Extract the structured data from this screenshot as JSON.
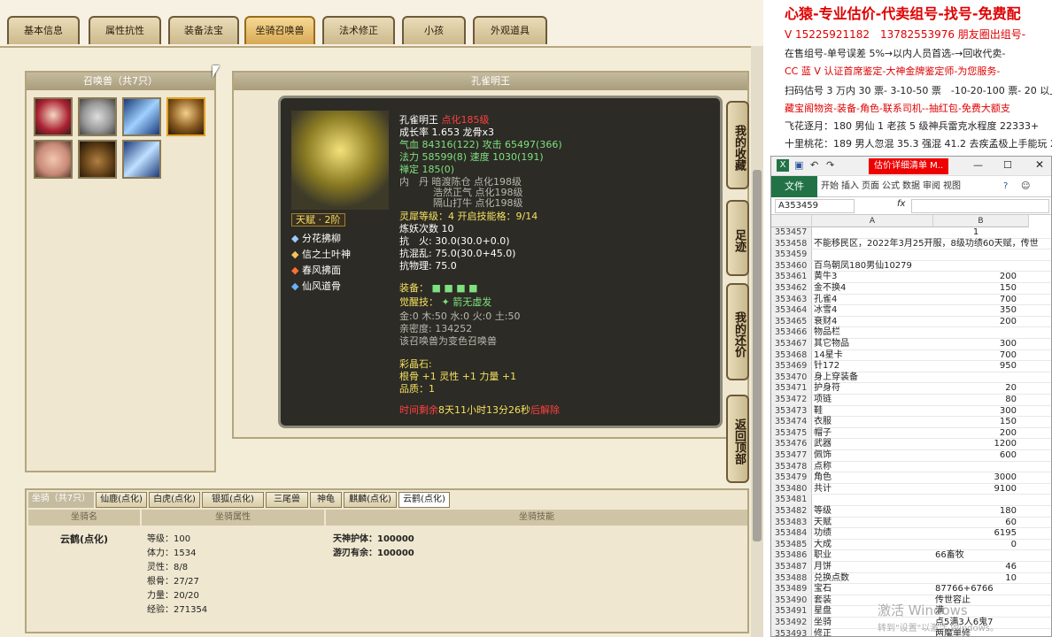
{
  "game": {
    "tabs": [
      "基本信息",
      "属性抗性",
      "装备法宝",
      "坐骑召唤兽",
      "法术修正",
      "小孩",
      "外观道具"
    ],
    "active_tab": 3,
    "pet_panel_title": "召唤兽（共7只）",
    "detail_title": "孔雀明王",
    "tooltip": {
      "name": "孔雀明王",
      "name_tag": "点化185级",
      "growth": "成长率 1.653 龙骨x3",
      "hp": "气血 84316(122) 攻击 65497(366)",
      "mp": "法力 58599(8) 速度 1030(191)",
      "zen": "禅定 185(0)",
      "inner1": "内　丹 暗渡陈仓 点化198级",
      "inner2": "浩然正气 点化198级",
      "inner3": "隔山打牛 点化198级",
      "talent": "天赋 · 2阶",
      "spirit": "灵犀等级：4 开启技能格：9/14",
      "refine": "炼妖次数 10",
      "resist1": "抗　火: 30.0(30.0+0.0)",
      "resist2": "抗混乱: 75.0(30.0+45.0)",
      "resist3": "抗物理: 75.0",
      "skills": [
        "分花拂柳",
        "信之土叶神",
        "春风拂面",
        "仙风道骨"
      ],
      "equip_label": "装备：",
      "awaken_label": "觉醒技：",
      "awaken": "箭无虚发",
      "elements": "金:0 木:50 水:0 火:0 土:50",
      "intimacy": "亲密度: 134252",
      "variant": "该召唤兽为变色召唤兽",
      "crystal_label": "彩晶石:",
      "crystal1": "根骨 +1 灵性 +1 力量 +1",
      "crystal2": "品质：1",
      "timer_pre": "时间剩余",
      "timer": "8天11小时13分26秒",
      "timer_post": "后解除"
    },
    "side_buttons": [
      "我的收藏",
      "足迹",
      "我的还价",
      "返回顶部"
    ],
    "mount": {
      "title": "坐骑（共7只）",
      "tabs": [
        "仙鹿(点化)",
        "白虎(点化)",
        "银狐(点化)",
        "三尾兽",
        "神龟",
        "麒麟(点化)",
        "云鹤(点化)"
      ],
      "headers": [
        "坐骑名",
        "坐骑属性",
        "坐骑技能"
      ],
      "name": "云鹤(点化)",
      "attrs": [
        "等级：100",
        "体力：1534",
        "灵性：8/8",
        "根骨：27/27",
        "力量：20/20",
        "经验：271354"
      ],
      "skills": [
        "天神护体：100000",
        "游刃有余：100000"
      ]
    }
  },
  "ad": {
    "lines": [
      {
        "text": "心猿-专业估价-代卖组号-找号-免费配",
        "color": "#e00000",
        "size": 16,
        "bold": true
      },
      {
        "text": "V 15225921182　13782553976 朋友圈出组号-",
        "color": "#e00000",
        "size": 12
      },
      {
        "text": "在售组号-单号误差 5%→以内人员首选-→回收代卖-",
        "color": "#222",
        "size": 11
      },
      {
        "text": "CC 蓝 V 认证首席鉴定-大神金牌鉴定师-为您服务-",
        "color": "#e00000",
        "size": 11
      },
      {
        "text": "扫码估号 3 万内 30 票- 3-10-50 票　-10-20-100 票- 20 以上 150",
        "color": "#222",
        "size": 11
      },
      {
        "text": "藏宝阁物资-装备-角色-联系司机--抽红包-免费大额支",
        "color": "#e00000",
        "size": 11
      },
      {
        "text": "飞花逐月：180 男仙 1 老孩 5 级神兵雷克水程度 22333+",
        "color": "#222",
        "size": 11
      },
      {
        "text": "十里桃花：189 男人忽混 35.3 强混 41.2 去疾孟极上手能玩 2",
        "color": "#222",
        "size": 11
      }
    ]
  },
  "excel": {
    "title": "估价详细清单 M..",
    "ribbon": [
      "开始",
      "插入",
      "页面",
      "公式",
      "数据",
      "审阅",
      "视图"
    ],
    "file": "文件",
    "namebox": "A353459",
    "fx": "fx",
    "columns": [
      "A",
      "B"
    ],
    "rows": [
      [
        "353457",
        "",
        "1"
      ],
      [
        "353458",
        "不能移民区，2022年3月25开服，8级功绩60天赋，传世",
        ""
      ],
      [
        "353459",
        "",
        ""
      ],
      [
        "353460",
        "百鸟朝凤180男仙10279",
        ""
      ],
      [
        "353461",
        "黄牛3",
        "200"
      ],
      [
        "353462",
        "金不换4",
        "150"
      ],
      [
        "353463",
        "孔雀4",
        "700"
      ],
      [
        "353464",
        "冰雪4",
        "350"
      ],
      [
        "353465",
        "衰财4",
        "200"
      ],
      [
        "353466",
        "物品栏",
        ""
      ],
      [
        "353467",
        "其它物品",
        "300"
      ],
      [
        "353468",
        "14星卡",
        "700"
      ],
      [
        "353469",
        "针172",
        "950"
      ],
      [
        "353470",
        "身上穿装备",
        ""
      ],
      [
        "353471",
        "护身符",
        "20"
      ],
      [
        "353472",
        "项链",
        "80"
      ],
      [
        "353473",
        "鞋",
        "300"
      ],
      [
        "353474",
        "衣服",
        "150"
      ],
      [
        "353475",
        "帽子",
        "200"
      ],
      [
        "353476",
        "武器",
        "1200"
      ],
      [
        "353477",
        "佩饰",
        "600"
      ],
      [
        "353478",
        "点称",
        ""
      ],
      [
        "353479",
        "角色",
        "3000"
      ],
      [
        "353480",
        "共计",
        "9100"
      ],
      [
        "353481",
        "",
        ""
      ],
      [
        "353482",
        "等级",
        "180"
      ],
      [
        "353483",
        "天赋",
        "60"
      ],
      [
        "353484",
        "功绩",
        "6195"
      ],
      [
        "353485",
        "大成",
        "0"
      ],
      [
        "353486",
        "职业",
        "66畜牧"
      ],
      [
        "353487",
        "月饼",
        "46"
      ],
      [
        "353488",
        "兑换点数",
        "10"
      ],
      [
        "353489",
        "宝石",
        "87766+6766"
      ],
      [
        "353490",
        "套装",
        "传世容止"
      ],
      [
        "353491",
        "星盘",
        "满"
      ],
      [
        "353492",
        "坐骑",
        "点5满3人6鬼7"
      ],
      [
        "353493",
        "修正",
        "两魔单修"
      ]
    ],
    "watermark1": "激活 Windows",
    "watermark2": "转到\"设置\"以激活 Windows。"
  }
}
